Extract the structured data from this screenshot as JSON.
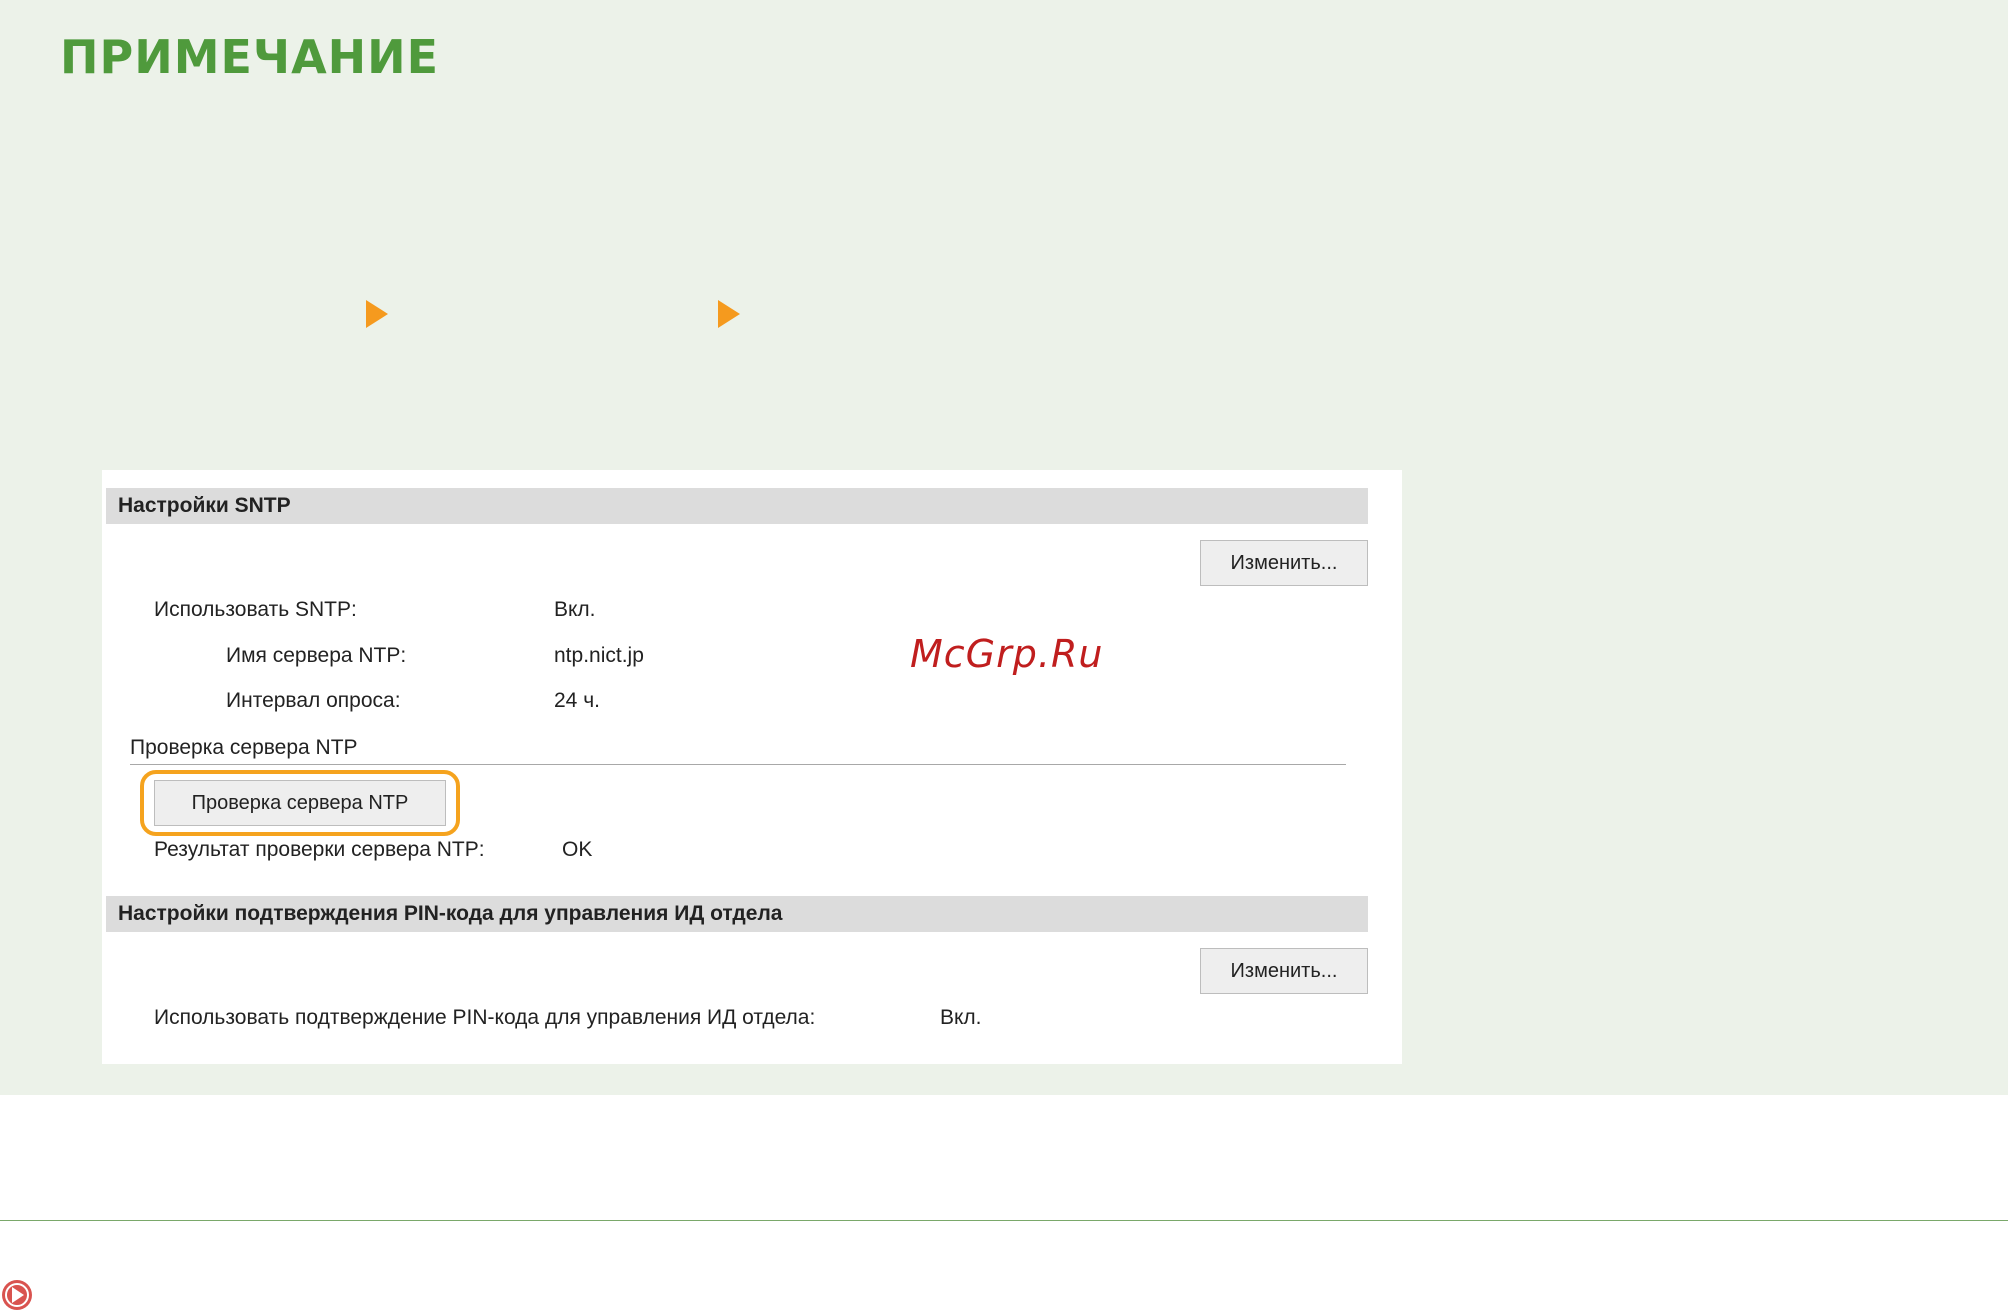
{
  "note": {
    "title": "ПРИМЕЧАНИЕ"
  },
  "colors": {
    "note_background": "#ecf2e9",
    "note_title": "#4f9a3c",
    "arrow": "#f59a1e",
    "highlight": "#f5a31e",
    "watermark": "#c01e1e"
  },
  "sntp_section": {
    "header": "Настройки SNTP",
    "edit_button": "Изменить...",
    "use_sntp_label": "Использовать SNTP:",
    "use_sntp_value": "Вкл.",
    "ntp_server_name_label": "Имя сервера NTP:",
    "ntp_server_name_value": "ntp.nict.jp",
    "polling_interval_label": "Интервал опроса:",
    "polling_interval_value": "24 ч.",
    "check_subheading": "Проверка сервера NTP",
    "check_button": "Проверка сервера NTP",
    "check_result_label": "Результат проверки сервера NTP:",
    "check_result_value": "OK"
  },
  "pin_section": {
    "header": "Настройки подтверждения PIN-кода для управления ИД отдела",
    "edit_button": "Изменить...",
    "use_pin_label": "Использовать подтверждение PIN-кода для управления ИД отдела:",
    "use_pin_value": "Вкл."
  },
  "watermark": {
    "text": "McGrp.Ru"
  },
  "icons": {
    "nav_arrow": "arrow-right-icon",
    "footer": "play-circle-icon"
  }
}
